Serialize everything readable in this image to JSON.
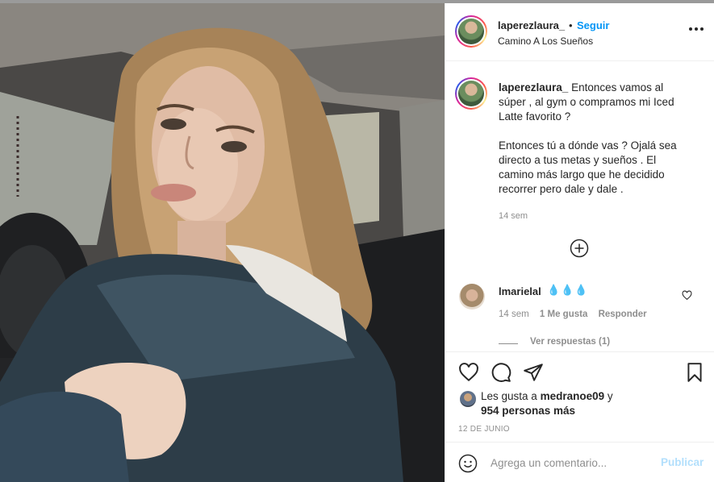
{
  "post": {
    "username": "laperezlaura_",
    "dot": "•",
    "follow_label": "Seguir",
    "location": "Camino A Los Sueños",
    "more_icon": "more-horizontal-icon",
    "caption_text": "Entonces vamos al súper , al gym o compramos mi Iced Latte favorito ?\n\nEntonces tú a dónde vas ? Ojalá sea directo a tus metas y sueños . El camino más largo que he decidido recorrer pero dale y dale .",
    "caption_time": "14 sem",
    "load_more_icon": "plus-circle-icon"
  },
  "comment": {
    "username": "lmarielal",
    "text": "💧💧💧",
    "time": "14 sem",
    "likes": "1 Me gusta",
    "reply_label": "Responder",
    "view_replies": "Ver respuestas (1)"
  },
  "actions": {
    "like_icon": "heart-icon",
    "comment_icon": "comment-icon",
    "share_icon": "paper-plane-icon",
    "save_icon": "bookmark-icon"
  },
  "likes": {
    "prefix": "Les gusta a ",
    "user": "medranoe09",
    "suffix": " y",
    "count": "954 personas más"
  },
  "date": "12 DE JUNIO",
  "add_comment": {
    "placeholder": "Agrega un comentario...",
    "publish_label": "Publicar",
    "emoji_icon": "smiley-icon"
  },
  "colors": {
    "link_blue": "#0095f6",
    "publish_disabled": "#b2dffc",
    "secondary_text": "#8e8e8e",
    "border": "#efefef"
  }
}
